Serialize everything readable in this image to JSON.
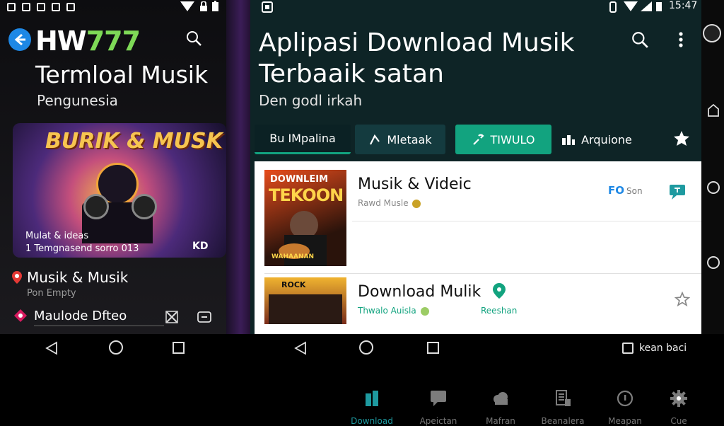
{
  "left": {
    "status_time": "",
    "app_title_a": "HW",
    "app_title_b": "777",
    "headline": "Termloal Musik",
    "subtitle": "Pengunesia",
    "banner": {
      "art_title": "BURIK & MUSK",
      "caption1": "Mulat & ideas",
      "caption2": "1 Temgnasend sorro 013",
      "badge": "KD"
    },
    "item1": {
      "title": "Musik & Musik",
      "sub": "Pon Empty"
    },
    "item2": {
      "title": "Maulode Dfteo"
    }
  },
  "right": {
    "status_time": "15:47",
    "title_line1": "Aplipasi Download Musik",
    "title_line2": "Terbaaik satan",
    "subtitle": "Den godl irkah",
    "tabs": [
      {
        "label": "Bu IMpalina",
        "icon": "none"
      },
      {
        "label": "Mletaak",
        "icon": "share-icon"
      },
      {
        "label": "TIWULO",
        "icon": "link-icon"
      },
      {
        "label": "Arquione",
        "icon": "chart-icon"
      }
    ],
    "card1": {
      "art_line1": "DOWNLEIM",
      "art_line2": "TEKOON",
      "art_line3": "WAHAANAN",
      "title": "Musik & Videic",
      "author": "Rawd Musle",
      "tag": "FO",
      "tag_label": "Son",
      "actions": [
        "Download",
        "Apeictan",
        "Mafran",
        "Beanalera",
        "Meapan",
        "Cue"
      ]
    },
    "card2": {
      "art_text": "ROCK",
      "title": "Download Mulik",
      "author": "Thwalo Auisla",
      "tag_label": "Reeshan"
    }
  },
  "navbar": {
    "right_label": "kean baci"
  },
  "colors": {
    "accent_green": "#12a37f",
    "teal_dark": "#0e2426",
    "tab_dark": "#143b3f",
    "brand_blue": "#1e88e5",
    "brand_green": "#7ed957",
    "icon_teal": "#1e9aa0",
    "icon_grey": "#7c7c7c"
  }
}
